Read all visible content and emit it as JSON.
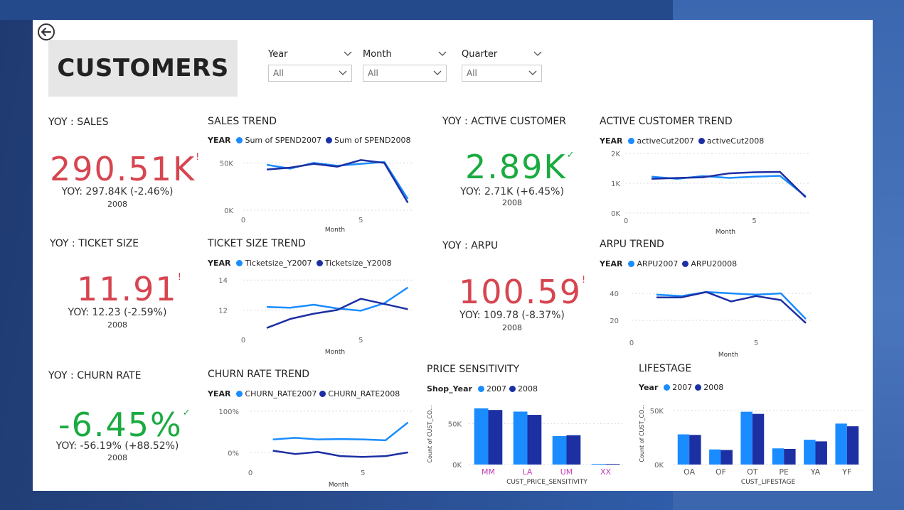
{
  "page": {
    "title": "CUSTOMERS"
  },
  "colors": {
    "series2007": "#1a8cff",
    "series2008": "#1c2fa3",
    "negative": "#d64550",
    "positive": "#1aab40"
  },
  "icons": {
    "back": "back-arrow-icon",
    "dropdown": "chevron-down-icon"
  },
  "slicers": [
    {
      "label": "Year",
      "value": "All"
    },
    {
      "label": "Month",
      "value": "All"
    },
    {
      "label": "Quarter",
      "value": "All"
    }
  ],
  "kpis": {
    "sales": {
      "title": "YOY : SALES",
      "value": "290.51K",
      "mark": "!",
      "goal": "YOY: 297.84K (-2.46%)",
      "year": "2008"
    },
    "ticket": {
      "title": "YOY : TICKET SIZE",
      "value": "11.91",
      "mark": "!",
      "goal": "YOY: 12.23 (-2.59%)",
      "year": "2008"
    },
    "churn": {
      "title": "YOY : CHURN RATE",
      "value": "-6.45%",
      "mark": "✓",
      "goal": "YOY: -56.19% (+88.52%)",
      "year": "2008"
    },
    "active": {
      "title": "YOY : ACTIVE CUSTOMER",
      "value": "2.89K",
      "mark": "✓",
      "goal": "YOY: 2.71K (+6.45%)",
      "year": "2008"
    },
    "arpu": {
      "title": "YOY : ARPU",
      "value": "100.59",
      "mark": "!",
      "goal": "YOY: 109.78 (-8.37%)",
      "year": "2008"
    }
  },
  "chart_data": [
    {
      "id": "sales_trend",
      "type": "line",
      "title": "SALES TREND",
      "legend_title": "YEAR",
      "xlabel": "Month",
      "ylabel": "",
      "x": [
        1,
        2,
        3,
        4,
        5,
        6,
        7
      ],
      "xticks": [
        0,
        5
      ],
      "xlim": [
        0,
        7.2
      ],
      "ylim": [
        0,
        60000
      ],
      "yticks": [
        {
          "v": 0,
          "label": "0K"
        },
        {
          "v": 50000,
          "label": "50K"
        }
      ],
      "series": [
        {
          "name": "Sum of SPEND2007",
          "values": [
            48000,
            44000,
            50000,
            47000,
            49000,
            51000,
            12000
          ]
        },
        {
          "name": "Sum of SPEND2008",
          "values": [
            43000,
            45000,
            49000,
            46000,
            53000,
            50000,
            8000
          ]
        }
      ]
    },
    {
      "id": "active_trend",
      "type": "line",
      "title": "ACTIVE CUSTOMER TREND",
      "legend_title": "YEAR",
      "xlabel": "Month",
      "ylabel": "",
      "x": [
        1,
        2,
        3,
        4,
        5,
        6,
        7
      ],
      "xticks": [
        0,
        5
      ],
      "xlim": [
        0,
        7.2
      ],
      "ylim": [
        0,
        2000
      ],
      "yticks": [
        {
          "v": 0,
          "label": "0K"
        },
        {
          "v": 1000,
          "label": "1K"
        },
        {
          "v": 2000,
          "label": "2K"
        }
      ],
      "series": [
        {
          "name": "activeCut2007",
          "values": [
            1220,
            1150,
            1240,
            1180,
            1220,
            1250,
            560
          ]
        },
        {
          "name": "activeCut2008",
          "values": [
            1150,
            1180,
            1200,
            1330,
            1370,
            1380,
            530
          ]
        }
      ]
    },
    {
      "id": "ticket_trend",
      "type": "line",
      "title": "TICKET SIZE TREND",
      "legend_title": "YEAR",
      "xlabel": "Month",
      "ylabel": "",
      "x": [
        1,
        2,
        3,
        4,
        5,
        6,
        7
      ],
      "xticks": [
        0,
        5
      ],
      "xlim": [
        0,
        7.2
      ],
      "ylim": [
        10.5,
        14.2
      ],
      "yticks": [
        {
          "v": 12,
          "label": "12"
        },
        {
          "v": 14,
          "label": "14"
        }
      ],
      "series": [
        {
          "name": "Ticketsize_Y2007",
          "values": [
            12.2,
            12.15,
            12.35,
            12.1,
            11.95,
            12.45,
            13.5
          ]
        },
        {
          "name": "Ticketsize_Y2008",
          "values": [
            10.8,
            11.4,
            11.75,
            12.0,
            12.75,
            12.4,
            12.05
          ]
        }
      ]
    },
    {
      "id": "arpu_trend",
      "type": "line",
      "title": "ARPU TREND",
      "legend_title": "YEAR",
      "xlabel": "Month",
      "ylabel": "",
      "x": [
        1,
        2,
        3,
        4,
        5,
        6,
        7
      ],
      "xticks": [
        0,
        5
      ],
      "xlim": [
        0,
        7.2
      ],
      "ylim": [
        10,
        50
      ],
      "yticks": [
        {
          "v": 20,
          "label": "20"
        },
        {
          "v": 40,
          "label": "40"
        }
      ],
      "series": [
        {
          "name": "ARPU2007",
          "values": [
            39,
            38,
            41,
            40,
            39,
            40,
            21
          ]
        },
        {
          "name": "ARPU20008",
          "values": [
            37,
            37,
            41,
            34,
            38,
            35,
            18
          ]
        }
      ]
    },
    {
      "id": "churn_trend",
      "type": "line",
      "title": "CHURN RATE TREND",
      "legend_title": "YEAR",
      "xlabel": "Month",
      "ylabel": "",
      "x": [
        1,
        2,
        3,
        4,
        5,
        6,
        7
      ],
      "xticks": [
        0,
        5
      ],
      "xlim": [
        0,
        7.2
      ],
      "ylim": [
        -30,
        110
      ],
      "yticks": [
        {
          "v": 0,
          "label": "0%"
        },
        {
          "v": 100,
          "label": "100%"
        }
      ],
      "series": [
        {
          "name": "CHURN_RATE2007",
          "values": [
            32,
            36,
            32,
            33,
            32,
            30,
            73
          ]
        },
        {
          "name": "CHURN_RATE2008",
          "values": [
            5,
            -3,
            2,
            -8,
            -10,
            -8,
            1
          ]
        }
      ]
    },
    {
      "id": "price_sensitivity",
      "type": "bar",
      "title": "PRICE SENSITIVITY",
      "legend_title": "Shop_Year",
      "xlabel": "CUST_PRICE_SENSITIVITY",
      "ylabel": "Count of CUST_CO...",
      "categories": [
        "MM",
        "LA",
        "UM",
        "XX"
      ],
      "ylim": [
        0,
        75000
      ],
      "yticks": [
        {
          "v": 0,
          "label": "0K"
        },
        {
          "v": 50000,
          "label": "50K"
        }
      ],
      "series": [
        {
          "name": "2007",
          "values": [
            69000,
            65000,
            35000,
            400
          ]
        },
        {
          "name": "2008",
          "values": [
            67000,
            61000,
            36000,
            300
          ]
        }
      ]
    },
    {
      "id": "lifestage",
      "type": "bar",
      "title": "LIFESTAGE",
      "legend_title": "Year",
      "xlabel": "CUST_LIFESTAGE",
      "ylabel": "Count of CUST_CO...",
      "categories": [
        "OA",
        "OF",
        "OT",
        "PE",
        "YA",
        "YF"
      ],
      "ylim": [
        0,
        58000
      ],
      "yticks": [
        {
          "v": 0,
          "label": "0K"
        },
        {
          "v": 50000,
          "label": "50K"
        }
      ],
      "series": [
        {
          "name": "2007",
          "values": [
            28000,
            14000,
            49000,
            15000,
            23000,
            38000
          ]
        },
        {
          "name": "2008",
          "values": [
            27500,
            13500,
            47000,
            14500,
            21500,
            35500
          ]
        }
      ]
    }
  ]
}
